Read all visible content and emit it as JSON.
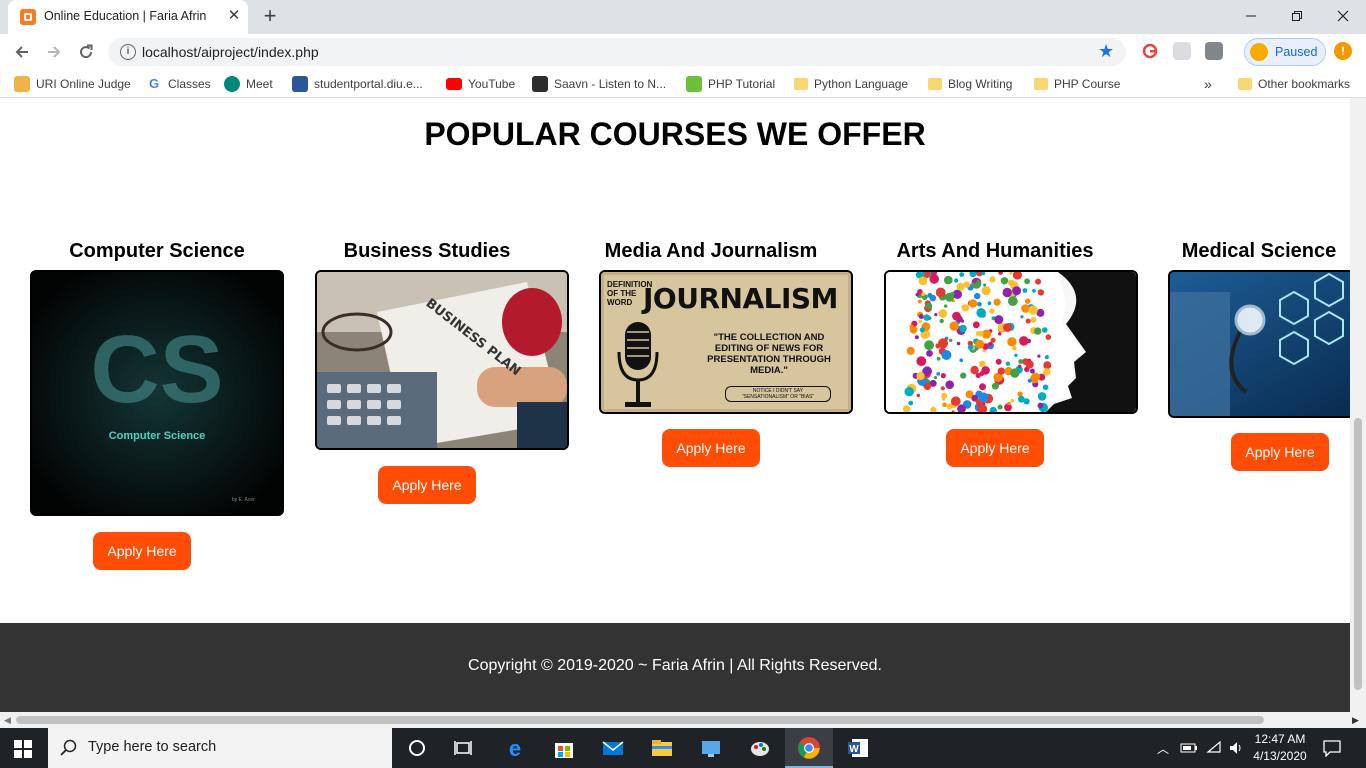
{
  "browser": {
    "tab_title": "Online Education | Faria Afrin",
    "url": "localhost/aiproject/index.php",
    "profile_label": "Paused",
    "bookmarks": [
      "URI Online Judge",
      "Classes",
      "Meet",
      "studentportal.diu.e...",
      "YouTube",
      "Saavn - Listen to N...",
      "PHP Tutorial",
      "Python Language",
      "Blog Writing",
      "PHP Course"
    ],
    "overflow_label": "»",
    "other_bookmarks": "Other bookmarks"
  },
  "page": {
    "heading": "POPULAR COURSES WE OFFER",
    "courses": [
      {
        "title": "Computer Science",
        "button": "Apply Here",
        "image_caption": "Computer Science",
        "image_signature": "by E. Acer",
        "image_words": "CS"
      },
      {
        "title": "Business Studies",
        "button": "Apply Here",
        "image_caption": "BUSINESS PLAN"
      },
      {
        "title": "Media And Journalism",
        "button": "Apply Here",
        "image_heading_small": "DEFINITION OF THE WORD",
        "image_heading_big": "JOURNALISM",
        "image_quote": "\"THE COLLECTION AND EDITING OF NEWS FOR PRESENTATION THROUGH MEDIA.\"",
        "image_note": "NOTICE I DIDN'T SAY \"SENSATIONALISM\" OR \"BIAS\""
      },
      {
        "title": "Arts And Humanities",
        "button": "Apply Here"
      },
      {
        "title": "Medical Science",
        "button": "Apply Here"
      }
    ],
    "footer": "Copyright © 2019-2020 ~ Faria Afrin | All Rights Reserved."
  },
  "taskbar": {
    "search_placeholder": "Type here to search",
    "time": "12:47 AM",
    "date": "4/13/2020"
  },
  "colors": {
    "apply_button": "#ff4d05",
    "footer_bg": "#333333",
    "chrome_accent": "#1a73e8"
  }
}
